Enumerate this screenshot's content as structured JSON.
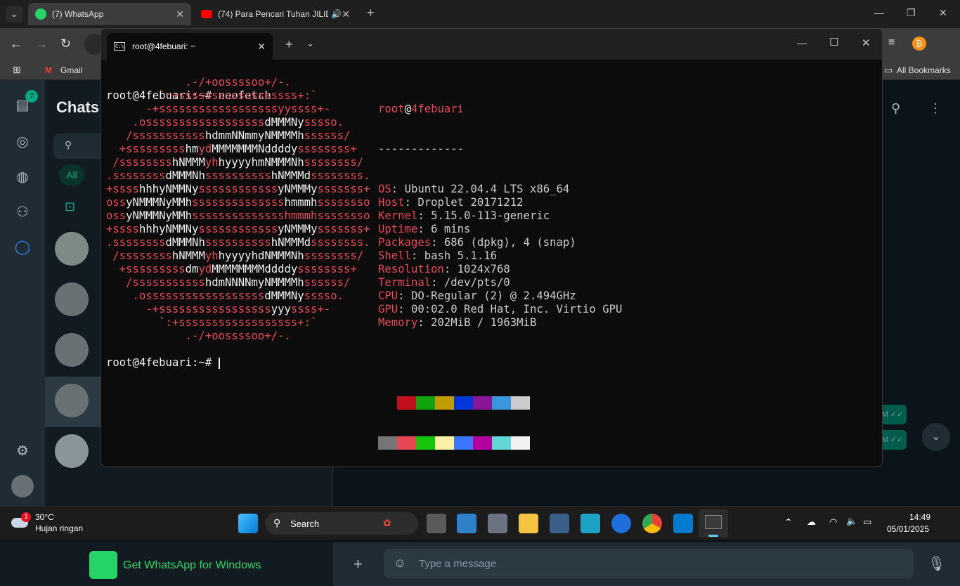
{
  "browser": {
    "tabs": [
      {
        "label": "(7) WhatsApp"
      },
      {
        "label": "(74) Para Pencari Tuhan JILID"
      }
    ],
    "bookmarks": {
      "gmail": "Gmail",
      "all": "All Bookmarks"
    }
  },
  "whatsapp": {
    "title": "Chats",
    "unread_badge": "7",
    "filter_all": "All",
    "get_app": "Get WhatsApp for Windows",
    "message_placeholder": "Type a message",
    "bubble_time_1": "M",
    "bubble_time_2": "M"
  },
  "terminal": {
    "tab_title": "root@4febuari: ~",
    "prompt": "root@4febuari:~#",
    "command": "neofetch",
    "user": "root",
    "at": "@",
    "host": "4febuari",
    "separator": "-------------",
    "info": [
      {
        "label": "OS",
        "value": "Ubuntu 22.04.4 LTS x86_64"
      },
      {
        "label": "Host",
        "value": "Droplet 20171212"
      },
      {
        "label": "Kernel",
        "value": "5.15.0-113-generic"
      },
      {
        "label": "Uptime",
        "value": "6 mins"
      },
      {
        "label": "Packages",
        "value": "686 (dpkg), 4 (snap)"
      },
      {
        "label": "Shell",
        "value": "bash 5.1.16"
      },
      {
        "label": "Resolution",
        "value": "1024x768"
      },
      {
        "label": "Terminal",
        "value": "/dev/pts/0"
      },
      {
        "label": "CPU",
        "value": "DO-Regular (2) @ 2.494GHz"
      },
      {
        "label": "GPU",
        "value": "00:02.0 Red Hat, Inc. Virtio GPU"
      },
      {
        "label": "Memory",
        "value": "202MiB / 1963MiB"
      }
    ],
    "palette_top": [
      "#0c0c0c",
      "#c50f1f",
      "#13a10e",
      "#c19c00",
      "#0037da",
      "#881798",
      "#3a96dd",
      "#cccccc"
    ],
    "palette_bottom": [
      "#767676",
      "#e74856",
      "#16c60c",
      "#f9f1a5",
      "#3b78ff",
      "#b4009e",
      "#61d6d6",
      "#f2f2f2"
    ],
    "ascii_art": [
      [
        [
          "r",
          "            .-/+oossssoo+/-."
        ]
      ],
      [
        [
          "r",
          "        `:+ssssssssssssssssss+:`"
        ]
      ],
      [
        [
          "r",
          "      -+ssssssssssssssssssyyssss+-"
        ]
      ],
      [
        [
          "r",
          "    .ossssssssssssssssss"
        ],
        [
          "w",
          "dMMMNy"
        ],
        [
          "r",
          "sssso."
        ]
      ],
      [
        [
          "r",
          "   /sssssssssss"
        ],
        [
          "w",
          "hdmmNNmmyNMMMMh"
        ],
        [
          "r",
          "ssssss/"
        ]
      ],
      [
        [
          "r",
          "  +sssssssss"
        ],
        [
          "w",
          "hm"
        ],
        [
          "r",
          "yd"
        ],
        [
          "w",
          "MMMMMMMNddddy"
        ],
        [
          "r",
          "ssssssss+"
        ]
      ],
      [
        [
          "r",
          " /ssssssss"
        ],
        [
          "w",
          "hNMMM"
        ],
        [
          "r",
          "yh"
        ],
        [
          "w",
          "hyyyyhmNMMMNh"
        ],
        [
          "r",
          "ssssssss/"
        ]
      ],
      [
        [
          "r",
          ".ssssssss"
        ],
        [
          "w",
          "dMMMNh"
        ],
        [
          "r",
          "ssssssssss"
        ],
        [
          "w",
          "hNMMMd"
        ],
        [
          "r",
          "ssssssss."
        ]
      ],
      [
        [
          "r",
          "+ssss"
        ],
        [
          "w",
          "hhhyNMMNy"
        ],
        [
          "r",
          "ssssssssssss"
        ],
        [
          "w",
          "yNMMMy"
        ],
        [
          "r",
          "sssssss+"
        ]
      ],
      [
        [
          "r",
          "oss"
        ],
        [
          "w",
          "yNMMMNyMMh"
        ],
        [
          "r",
          "ssssssssssssss"
        ],
        [
          "w",
          "hmmmh"
        ],
        [
          "r",
          "ssssssso"
        ]
      ],
      [
        [
          "r",
          "oss"
        ],
        [
          "w",
          "yNMMMNyMMh"
        ],
        [
          "r",
          "sssssssssssssshmmmhssssssso"
        ]
      ],
      [
        [
          "r",
          "+ssss"
        ],
        [
          "w",
          "hhhyNMMNy"
        ],
        [
          "r",
          "ssssssssssss"
        ],
        [
          "w",
          "yNMMMy"
        ],
        [
          "r",
          "sssssss+"
        ]
      ],
      [
        [
          "r",
          ".ssssssss"
        ],
        [
          "w",
          "dMMMNh"
        ],
        [
          "r",
          "ssssssssss"
        ],
        [
          "w",
          "hNMMMd"
        ],
        [
          "r",
          "ssssssss."
        ]
      ],
      [
        [
          "r",
          " /ssssssss"
        ],
        [
          "w",
          "hNMMM"
        ],
        [
          "r",
          "yh"
        ],
        [
          "w",
          "hyyyyhdNMMMNh"
        ],
        [
          "r",
          "ssssssss/"
        ]
      ],
      [
        [
          "r",
          "  +sssssssss"
        ],
        [
          "w",
          "dm"
        ],
        [
          "r",
          "yd"
        ],
        [
          "w",
          "MMMMMMMMddddy"
        ],
        [
          "r",
          "ssssssss+"
        ]
      ],
      [
        [
          "r",
          "   /sssssssssss"
        ],
        [
          "w",
          "hdmNNNNmyNMMMMh"
        ],
        [
          "r",
          "ssssss/"
        ]
      ],
      [
        [
          "r",
          "    .ossssssssssssssssss"
        ],
        [
          "w",
          "dMMMNy"
        ],
        [
          "r",
          "sssso."
        ]
      ],
      [
        [
          "r",
          "      -+sssssssssssssssss"
        ],
        [
          "w",
          "yyy"
        ],
        [
          "r",
          "ssss+-"
        ]
      ],
      [
        [
          "r",
          "        `:+ssssssssssssssssss+:`"
        ]
      ],
      [
        [
          "r",
          "            .-/+oossssoo+/-."
        ]
      ]
    ]
  },
  "taskbar": {
    "weather_temp": "30°C",
    "weather_desc": "Hujan ringan",
    "weather_badge": "1",
    "search_label": "Search",
    "time": "14:49",
    "date": "05/01/2025"
  }
}
